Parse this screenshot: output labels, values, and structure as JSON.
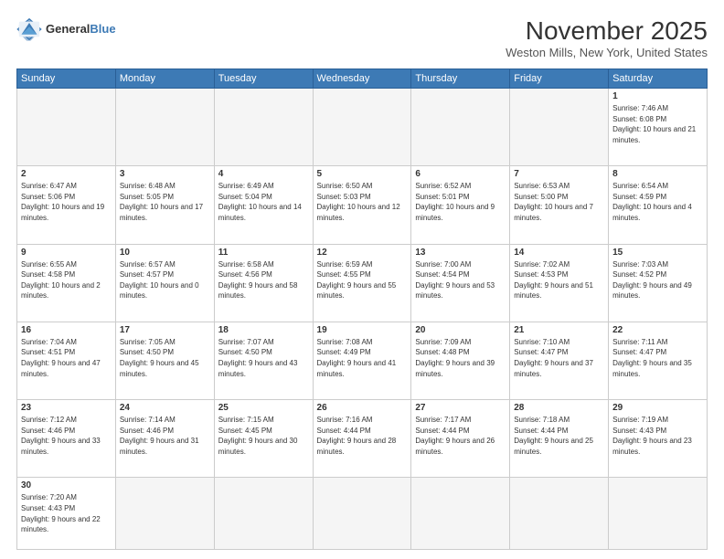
{
  "header": {
    "logo_general": "General",
    "logo_blue": "Blue",
    "month_title": "November 2025",
    "location": "Weston Mills, New York, United States"
  },
  "weekdays": [
    "Sunday",
    "Monday",
    "Tuesday",
    "Wednesday",
    "Thursday",
    "Friday",
    "Saturday"
  ],
  "weeks": [
    [
      {
        "day": "",
        "info": ""
      },
      {
        "day": "",
        "info": ""
      },
      {
        "day": "",
        "info": ""
      },
      {
        "day": "",
        "info": ""
      },
      {
        "day": "",
        "info": ""
      },
      {
        "day": "",
        "info": ""
      },
      {
        "day": "1",
        "info": "Sunrise: 7:46 AM\nSunset: 6:08 PM\nDaylight: 10 hours and 21 minutes."
      }
    ],
    [
      {
        "day": "2",
        "info": "Sunrise: 6:47 AM\nSunset: 5:06 PM\nDaylight: 10 hours and 19 minutes."
      },
      {
        "day": "3",
        "info": "Sunrise: 6:48 AM\nSunset: 5:05 PM\nDaylight: 10 hours and 17 minutes."
      },
      {
        "day": "4",
        "info": "Sunrise: 6:49 AM\nSunset: 5:04 PM\nDaylight: 10 hours and 14 minutes."
      },
      {
        "day": "5",
        "info": "Sunrise: 6:50 AM\nSunset: 5:03 PM\nDaylight: 10 hours and 12 minutes."
      },
      {
        "day": "6",
        "info": "Sunrise: 6:52 AM\nSunset: 5:01 PM\nDaylight: 10 hours and 9 minutes."
      },
      {
        "day": "7",
        "info": "Sunrise: 6:53 AM\nSunset: 5:00 PM\nDaylight: 10 hours and 7 minutes."
      },
      {
        "day": "8",
        "info": "Sunrise: 6:54 AM\nSunset: 4:59 PM\nDaylight: 10 hours and 4 minutes."
      }
    ],
    [
      {
        "day": "9",
        "info": "Sunrise: 6:55 AM\nSunset: 4:58 PM\nDaylight: 10 hours and 2 minutes."
      },
      {
        "day": "10",
        "info": "Sunrise: 6:57 AM\nSunset: 4:57 PM\nDaylight: 10 hours and 0 minutes."
      },
      {
        "day": "11",
        "info": "Sunrise: 6:58 AM\nSunset: 4:56 PM\nDaylight: 9 hours and 58 minutes."
      },
      {
        "day": "12",
        "info": "Sunrise: 6:59 AM\nSunset: 4:55 PM\nDaylight: 9 hours and 55 minutes."
      },
      {
        "day": "13",
        "info": "Sunrise: 7:00 AM\nSunset: 4:54 PM\nDaylight: 9 hours and 53 minutes."
      },
      {
        "day": "14",
        "info": "Sunrise: 7:02 AM\nSunset: 4:53 PM\nDaylight: 9 hours and 51 minutes."
      },
      {
        "day": "15",
        "info": "Sunrise: 7:03 AM\nSunset: 4:52 PM\nDaylight: 9 hours and 49 minutes."
      }
    ],
    [
      {
        "day": "16",
        "info": "Sunrise: 7:04 AM\nSunset: 4:51 PM\nDaylight: 9 hours and 47 minutes."
      },
      {
        "day": "17",
        "info": "Sunrise: 7:05 AM\nSunset: 4:50 PM\nDaylight: 9 hours and 45 minutes."
      },
      {
        "day": "18",
        "info": "Sunrise: 7:07 AM\nSunset: 4:50 PM\nDaylight: 9 hours and 43 minutes."
      },
      {
        "day": "19",
        "info": "Sunrise: 7:08 AM\nSunset: 4:49 PM\nDaylight: 9 hours and 41 minutes."
      },
      {
        "day": "20",
        "info": "Sunrise: 7:09 AM\nSunset: 4:48 PM\nDaylight: 9 hours and 39 minutes."
      },
      {
        "day": "21",
        "info": "Sunrise: 7:10 AM\nSunset: 4:47 PM\nDaylight: 9 hours and 37 minutes."
      },
      {
        "day": "22",
        "info": "Sunrise: 7:11 AM\nSunset: 4:47 PM\nDaylight: 9 hours and 35 minutes."
      }
    ],
    [
      {
        "day": "23",
        "info": "Sunrise: 7:12 AM\nSunset: 4:46 PM\nDaylight: 9 hours and 33 minutes."
      },
      {
        "day": "24",
        "info": "Sunrise: 7:14 AM\nSunset: 4:46 PM\nDaylight: 9 hours and 31 minutes."
      },
      {
        "day": "25",
        "info": "Sunrise: 7:15 AM\nSunset: 4:45 PM\nDaylight: 9 hours and 30 minutes."
      },
      {
        "day": "26",
        "info": "Sunrise: 7:16 AM\nSunset: 4:44 PM\nDaylight: 9 hours and 28 minutes."
      },
      {
        "day": "27",
        "info": "Sunrise: 7:17 AM\nSunset: 4:44 PM\nDaylight: 9 hours and 26 minutes."
      },
      {
        "day": "28",
        "info": "Sunrise: 7:18 AM\nSunset: 4:44 PM\nDaylight: 9 hours and 25 minutes."
      },
      {
        "day": "29",
        "info": "Sunrise: 7:19 AM\nSunset: 4:43 PM\nDaylight: 9 hours and 23 minutes."
      }
    ],
    [
      {
        "day": "30",
        "info": "Sunrise: 7:20 AM\nSunset: 4:43 PM\nDaylight: 9 hours and 22 minutes."
      },
      {
        "day": "",
        "info": ""
      },
      {
        "day": "",
        "info": ""
      },
      {
        "day": "",
        "info": ""
      },
      {
        "day": "",
        "info": ""
      },
      {
        "day": "",
        "info": ""
      },
      {
        "day": "",
        "info": ""
      }
    ]
  ]
}
